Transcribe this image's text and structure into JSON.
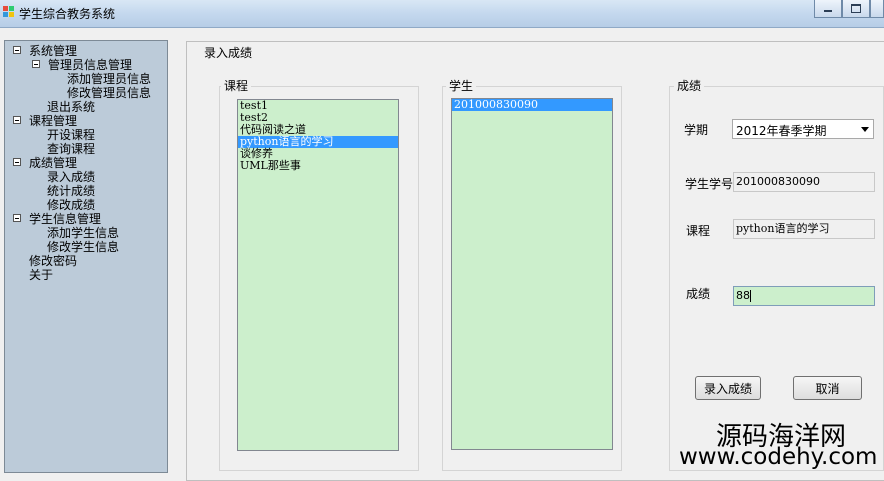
{
  "window": {
    "title": "学生综合教务系统"
  },
  "nav": {
    "items": [
      {
        "label": "系统管理",
        "level": 0,
        "toggle": true
      },
      {
        "label": "管理员信息管理",
        "level": 1,
        "toggle": true
      },
      {
        "label": "添加管理员信息",
        "level": 2,
        "toggle": false
      },
      {
        "label": "修改管理员信息",
        "level": 2,
        "toggle": false
      },
      {
        "label": "退出系统",
        "level": 1,
        "toggle": false
      },
      {
        "label": "课程管理",
        "level": 0,
        "toggle": true
      },
      {
        "label": "开设课程",
        "level": 1,
        "toggle": false
      },
      {
        "label": "查询课程",
        "level": 1,
        "toggle": false
      },
      {
        "label": "成绩管理",
        "level": 0,
        "toggle": true
      },
      {
        "label": "录入成绩",
        "level": 1,
        "toggle": false
      },
      {
        "label": "统计成绩",
        "level": 1,
        "toggle": false
      },
      {
        "label": "修改成绩",
        "level": 1,
        "toggle": false
      },
      {
        "label": "学生信息管理",
        "level": 0,
        "toggle": true
      },
      {
        "label": "添加学生信息",
        "level": 1,
        "toggle": false
      },
      {
        "label": "修改学生信息",
        "level": 1,
        "toggle": false
      },
      {
        "label": "修改密码",
        "level": "root",
        "toggle": false
      },
      {
        "label": "关于",
        "level": "root",
        "toggle": false
      }
    ]
  },
  "form": {
    "title": "录入成绩",
    "courses": {
      "title": "课程",
      "items": [
        "test1",
        "test2",
        "代码阅读之道",
        "python语言的学习",
        "谈修养",
        "UML那些事"
      ],
      "selected_index": 3
    },
    "students": {
      "title": "学生",
      "items": [
        "201000830090"
      ],
      "selected_index": 0
    },
    "grade": {
      "title": "成绩",
      "semester_label": "学期",
      "semester_value": "2012年春季学期",
      "student_id_label": "学生学号",
      "student_id_value": "201000830090",
      "course_label": "课程",
      "course_value": "python语言的学习",
      "score_label": "成绩",
      "score_value": "88",
      "submit_label": "录入成绩",
      "cancel_label": "取消"
    }
  },
  "watermark": {
    "line1": "源码海洋网",
    "line2": "www.codehy.com"
  },
  "colors": {
    "list_bg": "#ccefcc",
    "selection": "#3399ff",
    "tree_bg": "#bccbd9"
  }
}
